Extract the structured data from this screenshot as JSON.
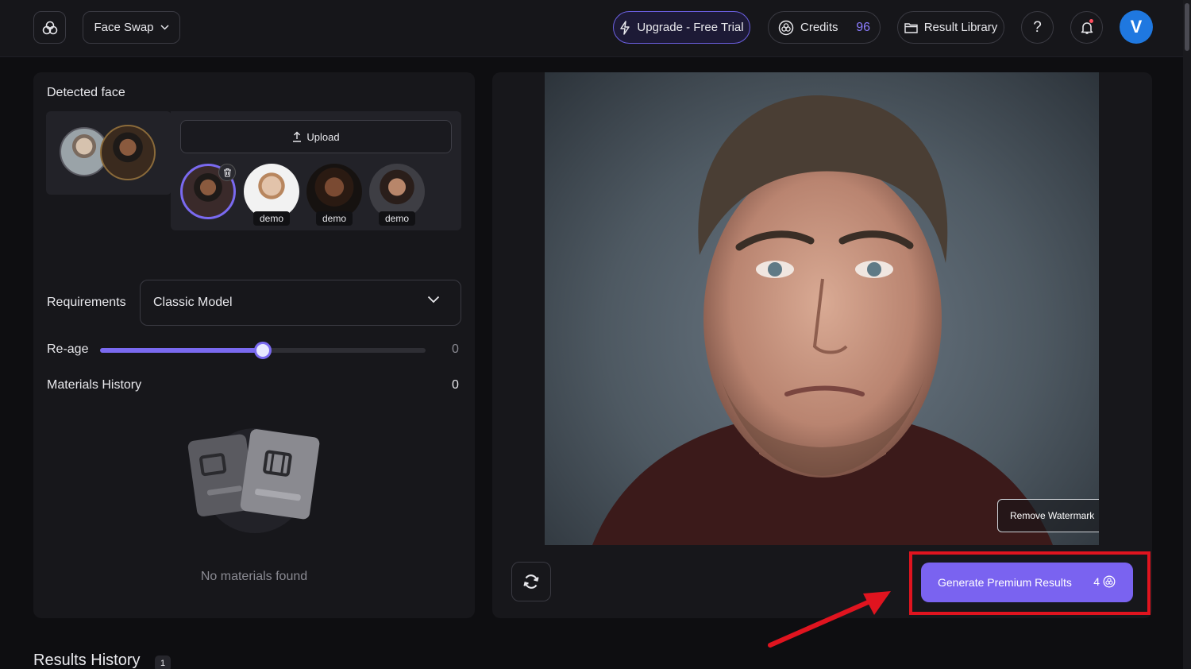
{
  "header": {
    "mode_label": "Face Swap",
    "upgrade_label": "Upgrade - Free Trial",
    "credits_label": "Credits",
    "credits_value": "96",
    "library_label": "Result Library",
    "help_label": "?",
    "avatar_initial": "V",
    "icons": [
      "logo-icon",
      "chevron-down-icon",
      "lightning-icon",
      "credits-icon",
      "folder-icon",
      "bell-icon"
    ]
  },
  "left": {
    "detected_title": "Detected face",
    "upload_label": "Upload",
    "demo_labels": [
      "demo",
      "demo",
      "demo"
    ],
    "requirements_label": "Requirements",
    "model_value": "Classic Model",
    "reage_label": "Re-age",
    "reage_value": "0",
    "reage_slider_fraction": 0.5,
    "materials_label": "Materials History",
    "materials_count": "0",
    "empty_text": "No materials found"
  },
  "right": {
    "remove_watermark_label": "Remove Watermark",
    "generate_label": "Generate Premium Results",
    "generate_cost": "4"
  },
  "results": {
    "title": "Results History",
    "count": "1"
  },
  "colors": {
    "accent": "#7a63f0",
    "highlight": "#e0141f",
    "background": "#0e0e11",
    "panel": "#17171b"
  }
}
